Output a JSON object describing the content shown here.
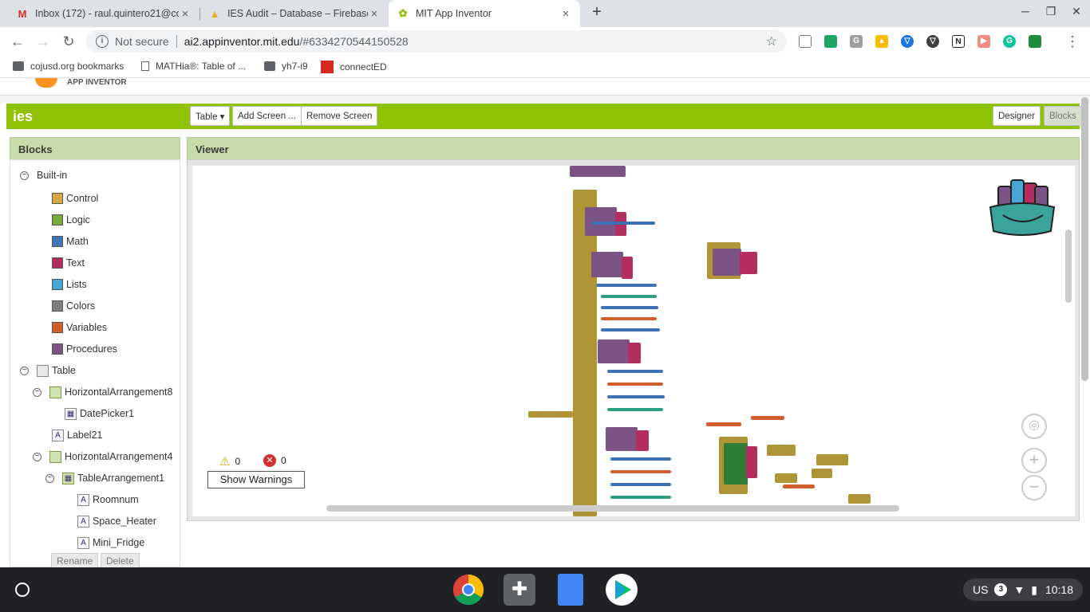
{
  "browser": {
    "tabs": [
      {
        "title": "Inbox (172) - raul.quintero21@co",
        "icon": "gmail-icon"
      },
      {
        "title": "IES Audit – Database – Firebase",
        "icon": "firebase-icon"
      },
      {
        "title": "MIT App Inventor",
        "icon": "app-inventor-icon"
      }
    ],
    "address": {
      "security": "Not secure",
      "host": "ai2.appinventor.mit.edu",
      "path": "/#6334270544150528"
    },
    "bookmarks": [
      "cojusd.org bookmarks",
      "MATHia®: Table of ...",
      "yh7-i9",
      "connectED"
    ]
  },
  "app": {
    "logo_text": "APP INVENTOR",
    "project_name": "ies",
    "screen_dropdown": "Table ▾",
    "add_screen": "Add Screen ...",
    "remove_screen": "Remove Screen",
    "designer": "Designer",
    "blocks": "Blocks"
  },
  "blocks_panel": {
    "title": "Blocks",
    "builtin": "Built-in",
    "categories": [
      {
        "label": "Control",
        "color": "#d9a842"
      },
      {
        "label": "Logic",
        "color": "#77ab41"
      },
      {
        "label": "Math",
        "color": "#3f71b5"
      },
      {
        "label": "Text",
        "color": "#b32d5e"
      },
      {
        "label": "Lists",
        "color": "#49a6d4"
      },
      {
        "label": "Colors",
        "color": "#7d7d7d"
      },
      {
        "label": "Variables",
        "color": "#d05f2d"
      },
      {
        "label": "Procedures",
        "color": "#7c5385"
      }
    ],
    "components": {
      "root": "Table",
      "h8": "HorizontalArrangement8",
      "date": "DatePicker1",
      "label21": "Label21",
      "h4": "HorizontalArrangement4",
      "table1": "TableArrangement1",
      "roomnum": "Roomnum",
      "heater": "Space_Heater",
      "fridge": "Mini_Fridge"
    },
    "rename": "Rename",
    "delete": "Delete"
  },
  "viewer": {
    "title": "Viewer",
    "warnings_count": "0",
    "errors_count": "0",
    "show_warnings": "Show Warnings"
  },
  "taskbar": {
    "locale": "US",
    "notifications": "3",
    "time": "10:18"
  }
}
